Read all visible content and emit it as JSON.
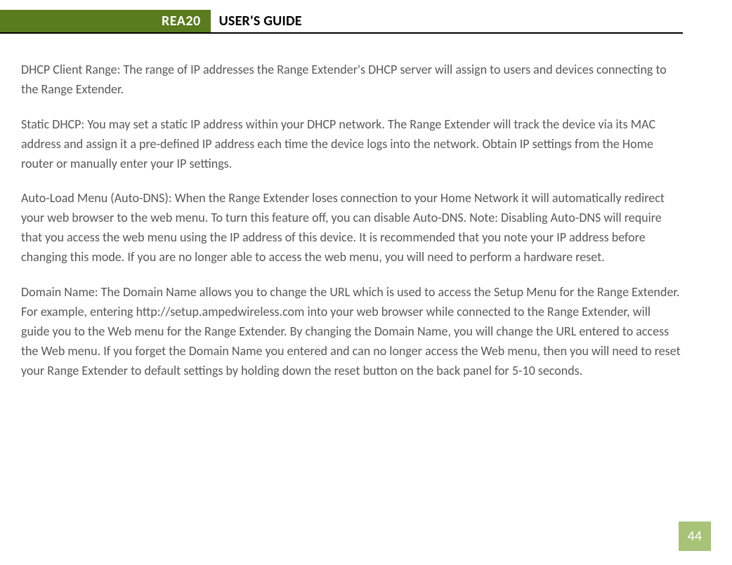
{
  "header": {
    "badge": "REA20",
    "title": "USER'S GUIDE"
  },
  "paragraphs": {
    "p1": "DHCP Client Range: The range of IP addresses the Range Extender's DHCP server will assign to users and devices connecting to the Range Extender.",
    "p2": "Static DHCP: You may set a static IP address within your DHCP network. The Range Extender will track the device via its MAC address and assign it a pre-defined IP address each time the device logs into the network. Obtain IP settings from the Home router or manually enter your IP settings.",
    "p3": "Auto-Load Menu (Auto-DNS): When the Range Extender loses connection to your Home Network it will automatically redirect your web browser to the web menu. To turn this feature off, you can disable Auto-DNS. Note: Disabling Auto-DNS will require that you access the web menu using the IP address of this device. It is recommended that you note your IP address before changing this mode. If you are no longer able to access the web menu, you will need to perform a hardware reset.",
    "p4": "Domain Name: The Domain Name allows you to change the URL which is used to access the Setup Menu for the Range Extender. For example, entering http://setup.ampedwireless.com into your web browser while connected to the Range Extender, will guide you to the Web menu for the Range Extender. By changing the Domain Name, you will change the URL entered to access the Web menu. If you forget the Domain Name you entered and can no longer access the Web menu, then you will need to reset your Range Extender to default settings by holding down the reset button on the back panel for 5-10 seconds."
  },
  "page_number": "44"
}
